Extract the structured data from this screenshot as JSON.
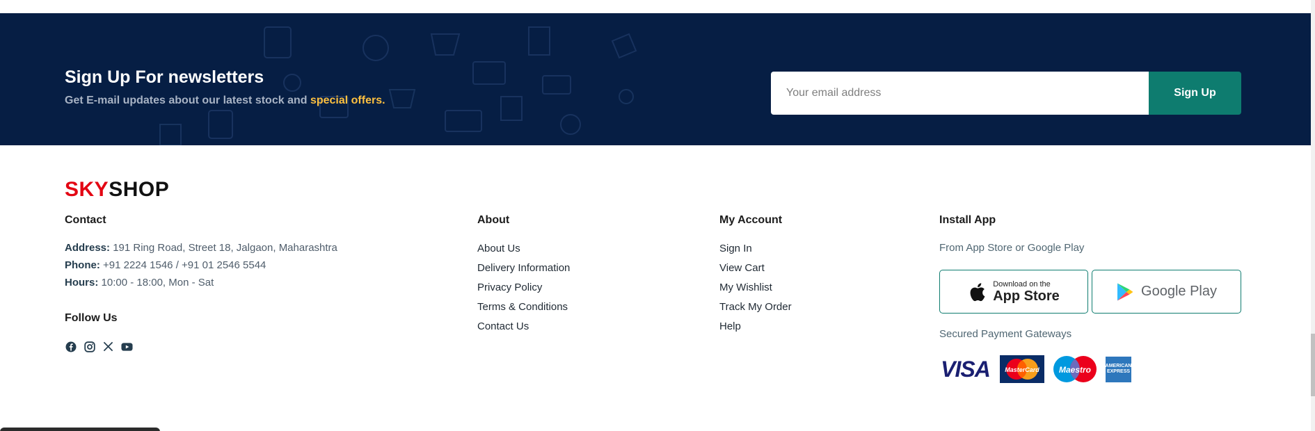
{
  "newsletter": {
    "title": "Sign Up For newsletters",
    "subtitle_prefix": "Get E-mail updates about our latest stock and ",
    "subtitle_highlight": "special offers.",
    "email_placeholder": "Your email address",
    "button_label": "Sign Up"
  },
  "brand": {
    "sky": "SKY",
    "shop": "SHOP"
  },
  "contact": {
    "title": "Contact",
    "address_label": "Address:",
    "address_value": " 191 Ring Road, Street 18, Jalgaon, Maharashtra",
    "phone_label": "Phone:",
    "phone_value": " +91 2224 1546 / +91 01 2546 5544",
    "hours_label": "Hours:",
    "hours_value": " 10:00 - 18:00, Mon - Sat"
  },
  "follow": {
    "title": "Follow Us",
    "icons": [
      "facebook-icon",
      "instagram-icon",
      "x-icon",
      "youtube-icon"
    ]
  },
  "about": {
    "title": "About",
    "links": [
      "About Us",
      "Delivery Information",
      "Privacy Policy",
      "Terms & Conditions",
      "Contact Us"
    ]
  },
  "account": {
    "title": "My Account",
    "links": [
      "Sign In",
      "View Cart",
      "My Wishlist",
      "Track My Order",
      "Help"
    ]
  },
  "install": {
    "title": "Install App",
    "subtitle": "From App Store or Google Play",
    "appstore_small": "Download on the",
    "appstore_big": "App Store",
    "googleplay": "Google Play",
    "payments_title": "Secured Payment Gateways",
    "payments": {
      "visa": "VISA",
      "mastercard": "MasterCard",
      "maestro": "Maestro",
      "amex": "AMERICAN EXPRESS"
    }
  },
  "colors": {
    "navy": "#061E44",
    "teal": "#0E7C6F",
    "highlight": "#FDC040",
    "brand_red": "#E30613"
  }
}
